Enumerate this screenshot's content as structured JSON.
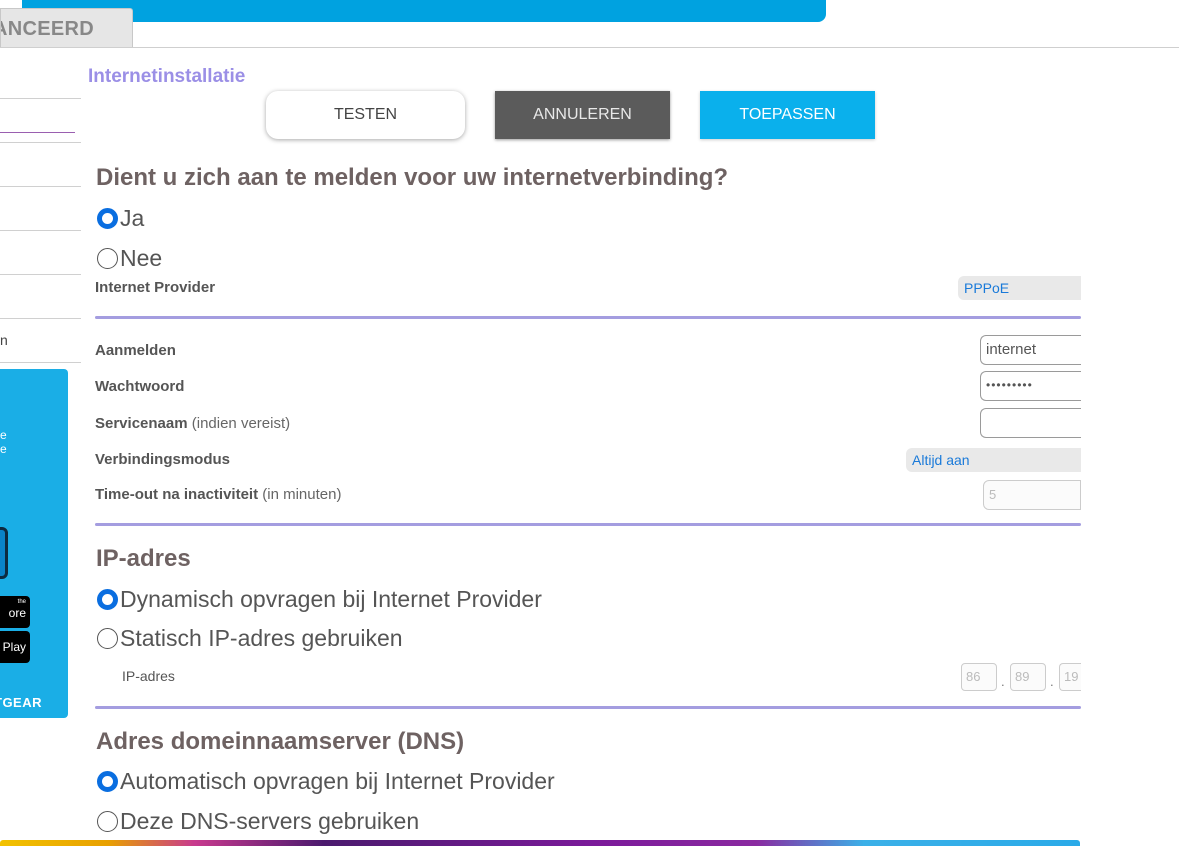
{
  "tabs": {
    "advanced": "ANCEERD"
  },
  "sidebar": {
    "fragment_label": "n",
    "promo": {
      "line1": "e",
      "line2": "e",
      "app_store_small": "the",
      "app_store": "ore",
      "google_play": "Play",
      "brand": "TGEAR"
    }
  },
  "page": {
    "title": "Internetinstallatie"
  },
  "toolbar": {
    "test_label": "TESTEN",
    "cancel_label": "ANNULEREN",
    "apply_label": "TOEPASSEN"
  },
  "login_section": {
    "question": "Dient u zich aan te melden voor uw internetverbinding?",
    "options": [
      {
        "label": "Ja",
        "selected": true
      },
      {
        "label": "Nee",
        "selected": false
      }
    ],
    "provider_label": "Internet Provider",
    "provider_value": "PPPoE",
    "login_label": "Aanmelden",
    "login_value": "internet",
    "password_label": "Wachtwoord",
    "password_value": "•••••••••",
    "service_label": "Servicenaam",
    "service_hint": "(indien vereist)",
    "service_value": "",
    "mode_label": "Verbindingsmodus",
    "mode_value": "Altijd aan",
    "timeout_label": "Time-out na inactiviteit",
    "timeout_hint": "(in minuten)",
    "timeout_value": "5"
  },
  "ip_section": {
    "title": "IP-adres",
    "options": [
      {
        "label": "Dynamisch opvragen bij Internet Provider",
        "selected": true
      },
      {
        "label": "Statisch IP-adres gebruiken",
        "selected": false
      }
    ],
    "ip_label": "IP-adres",
    "ip_octets": [
      "86",
      "89",
      "19"
    ]
  },
  "dns_section": {
    "title": "Adres domeinnaamserver (DNS)",
    "options": [
      {
        "label": "Automatisch opvragen bij Internet Provider",
        "selected": true
      },
      {
        "label": "Deze DNS-servers gebruiken",
        "selected": false
      }
    ]
  },
  "colors": {
    "accent_blue": "#0ab0ec",
    "title_purple": "#9b8fe6",
    "divider": "#a49de0",
    "radio_checked": "#0a6ee0"
  }
}
